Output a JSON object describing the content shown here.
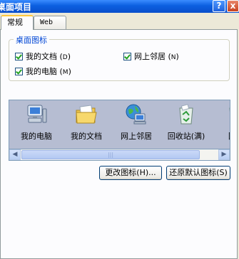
{
  "window": {
    "title": "桌面项目",
    "help_label": "?",
    "close_label": "x"
  },
  "tabs": [
    {
      "label": "常规",
      "active": true
    },
    {
      "label": "Web",
      "active": false
    }
  ],
  "desktop_icons_group": {
    "legend": "桌面图标",
    "checkboxes": [
      {
        "label": "我的文档 (",
        "accel": "D",
        "suffix": ")",
        "checked": true
      },
      {
        "label": "网上邻居 (",
        "accel": "N",
        "suffix": ")",
        "checked": true
      },
      {
        "label": "我的电脑 (",
        "accel": "M",
        "suffix": ")",
        "checked": true
      }
    ]
  },
  "icon_list": {
    "items": [
      {
        "label": "我的电脑",
        "icon": "my-computer-icon"
      },
      {
        "label": "我的文档",
        "icon": "my-documents-icon"
      },
      {
        "label": "网上邻居",
        "icon": "network-places-icon"
      },
      {
        "label": "回收站(满)",
        "icon": "recycle-bin-full-icon"
      },
      {
        "label": "回收",
        "icon": "recycle-bin-empty-icon"
      }
    ],
    "scroll_left": "◀",
    "scroll_right": "▶",
    "thumb_grip": "|||"
  },
  "buttons": {
    "change_icon": "更改图标(H)...",
    "restore_default": "还原默认图标(S)"
  },
  "colors": {
    "titlebar": "#0B5FE0",
    "group_legend": "#0046D5",
    "list_background": "#B6BDD2",
    "tab_highlight": "#FFC83C"
  }
}
